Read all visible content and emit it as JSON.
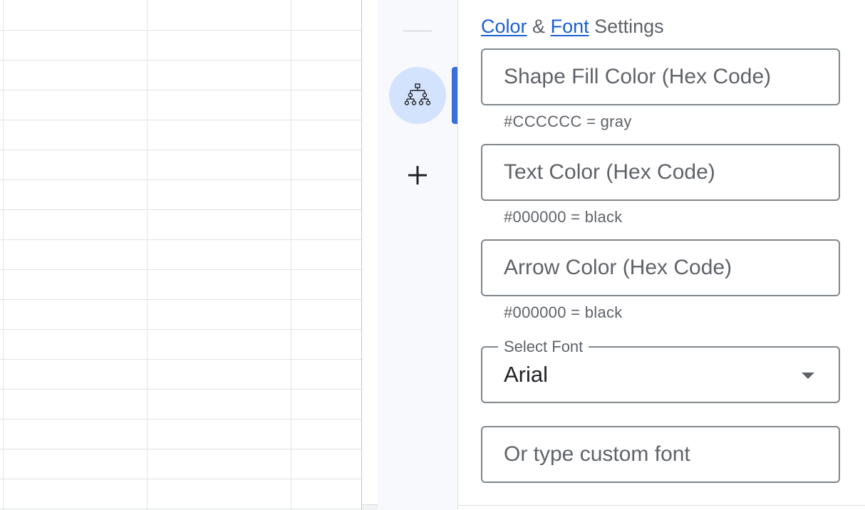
{
  "panel": {
    "heading": {
      "color_link": "Color",
      "amp": "&",
      "font_link": "Font",
      "suffix": "Settings"
    },
    "shape_fill": {
      "placeholder": "Shape Fill Color (Hex Code)",
      "hint": "#CCCCCC = gray"
    },
    "text_color": {
      "placeholder": "Text Color (Hex Code)",
      "hint": "#000000 = black"
    },
    "arrow_color": {
      "placeholder": "Arrow Color (Hex Code)",
      "hint": "#000000 = black"
    },
    "font_select": {
      "label": "Select Font",
      "value": "Arial"
    },
    "custom_font": {
      "placeholder": "Or type custom font"
    }
  },
  "rail": {
    "addon_icon": "org-chart-icon",
    "add_icon": "plus-icon"
  },
  "colors": {
    "link": "#1a5fd6",
    "accent": "#3c6fd8",
    "addon_bg": "#d3e3fd",
    "gridline": "#e2e3e3"
  }
}
